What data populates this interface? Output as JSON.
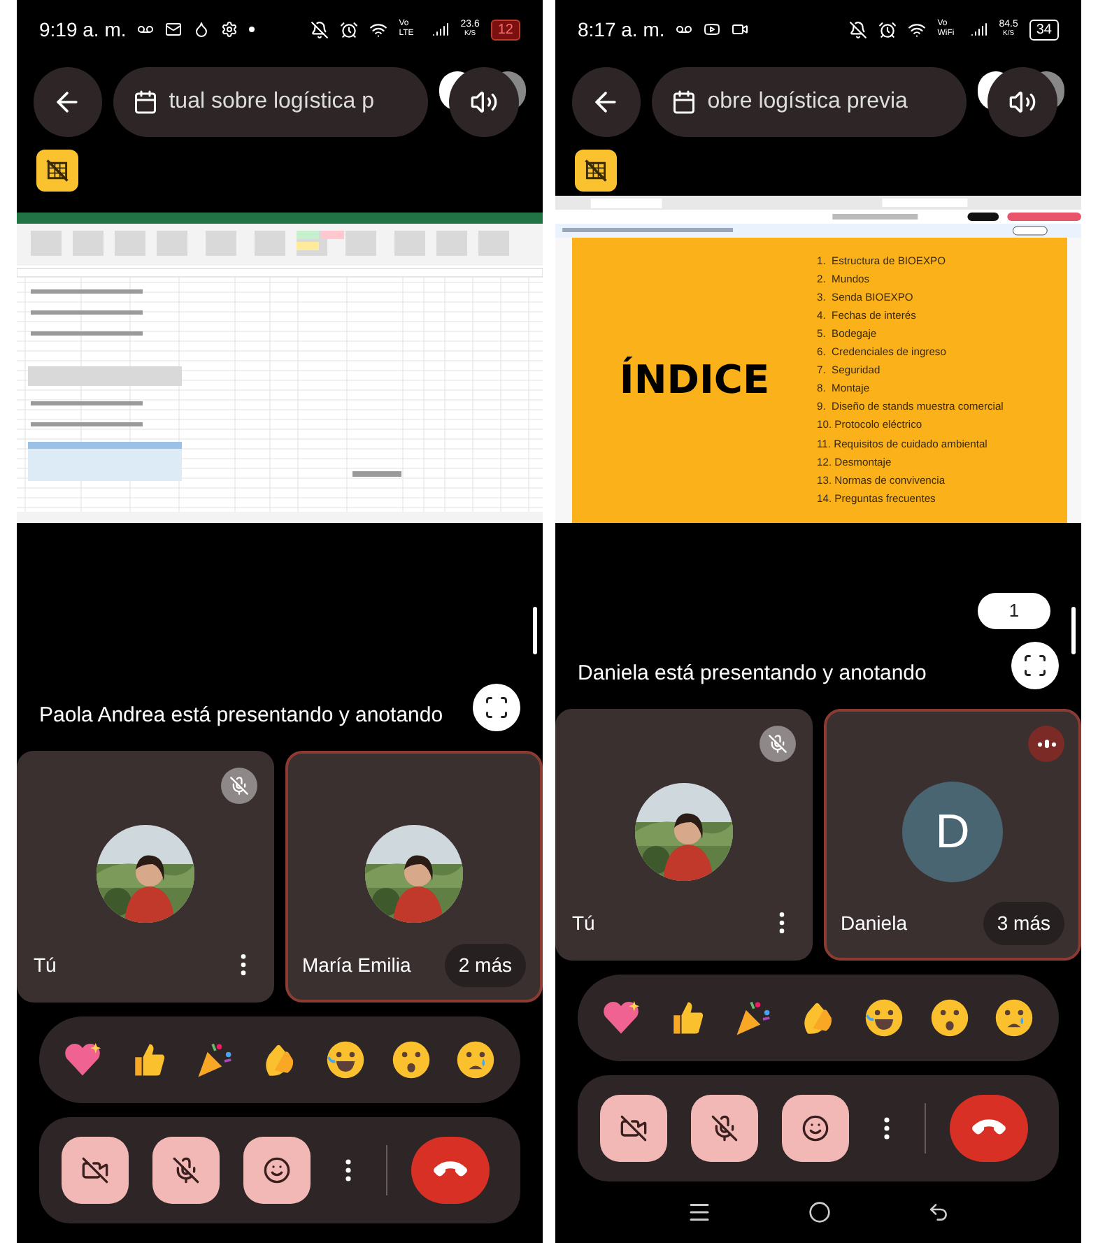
{
  "phones": [
    {
      "status_bar": {
        "time": "9:19 a. m.",
        "notifications": [
          {
            "kind": "voicemail"
          },
          {
            "kind": "mail"
          },
          {
            "kind": "drop"
          },
          {
            "kind": "gear"
          },
          {
            "kind": "dot"
          }
        ],
        "network": "Vo LTE",
        "speed": "23.6",
        "speed_unit": "K/S",
        "battery": "12",
        "battery_low": true
      },
      "meeting_title": "tual sobre logística p",
      "shared": {
        "kind": "spreadsheet"
      },
      "presenting_text": "Paola Andrea está presentando y anotando",
      "participants": [
        {
          "name": "Tú",
          "muted": true,
          "highlighted": false,
          "speaking": false,
          "menu": true
        },
        {
          "name": "María Emilia",
          "muted": false,
          "highlighted": true,
          "speaking": false,
          "menu": false,
          "more": "2 más"
        }
      ],
      "nav_bar": false
    },
    {
      "status_bar": {
        "time": "8:17 a. m.",
        "notifications": [
          {
            "kind": "voicemail"
          },
          {
            "kind": "video"
          },
          {
            "kind": "camera"
          }
        ],
        "network": "Vo WiFi",
        "speed": "84.5",
        "speed_unit": "K/S",
        "battery": "34",
        "battery_low": false
      },
      "meeting_title": "obre logística previa",
      "page_counter": "1",
      "shared": {
        "kind": "slide",
        "title": "ÍNDICE",
        "items": [
          "1.  Estructura de BIOEXPO",
          "2.  Mundos",
          "3.  Senda BIOEXPO",
          "4.  Fechas de interés",
          "5.  Bodegaje",
          "6.  Credenciales de ingreso",
          "7.  Seguridad",
          "8.  Montaje",
          "9.  Diseño de stands muestra comercial",
          "10. Protocolo eléctrico",
          "11. Requisitos de cuidado ambiental",
          "12. Desmontaje",
          "13. Normas de convivencia",
          "14. Preguntas frecuentes"
        ]
      },
      "presenting_text": "Daniela está presentando y anotando",
      "participants": [
        {
          "name": "Tú",
          "muted": true,
          "highlighted": false,
          "speaking": false,
          "menu": true
        },
        {
          "name": "Daniela",
          "kind": "initial",
          "initial": "D",
          "muted": false,
          "highlighted": true,
          "speaking": true,
          "menu": false,
          "more": "3 más"
        }
      ],
      "nav_bar": true
    }
  ]
}
